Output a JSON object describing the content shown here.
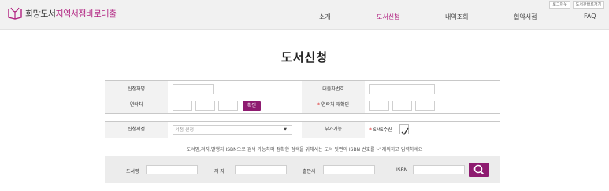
{
  "header": {
    "logo_part1": "희망도서",
    "logo_part2": "지역서점바로대출",
    "util_links": [
      "로그아웃",
      "도서관바로가기"
    ],
    "nav": [
      {
        "label": "소개",
        "active": false
      },
      {
        "label": "도서신청",
        "active": true
      },
      {
        "label": "내역조회",
        "active": false
      },
      {
        "label": "협약서점",
        "active": false
      },
      {
        "label": "FAQ",
        "active": false
      }
    ]
  },
  "page_title": "도서신청",
  "form": {
    "applicant_label": "신청자명",
    "borrower_no_label": "대출자번호",
    "contact_label": "연락처",
    "confirm_button": "확인",
    "contact_reconfirm_label": "연락처 재확인",
    "required_mark": "*",
    "bookstore_label": "신청서점",
    "bookstore_placeholder": "서점 선정",
    "dropdown_arrow": "▼",
    "extra_label": "부가기능",
    "sms_label": "SMS수신",
    "sms_checked": true
  },
  "notice": "도서명,저자,발행자,ISBN으로 검색 가능하며 정확한 검색을 위해서는 도서 뒷면의 ISBN 번호를 '-' 제외하고 입력하세요",
  "search": {
    "title_label": "도서명",
    "author_label": "저 자",
    "publisher_label": "출판사",
    "isbn_label": "ISBN"
  },
  "colors": {
    "accent": "#b0207f",
    "button": "#8e1b70",
    "header_bg": "#f1f1f1",
    "label_bg": "#f2f2f2",
    "search_bg": "#ececec"
  }
}
